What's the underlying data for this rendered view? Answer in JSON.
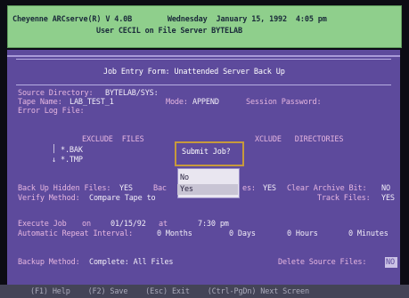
{
  "header": {
    "line1": "Cheyenne ARCserve(R) V 4.0B        Wednesday  January 15, 1992  4:05 pm",
    "line2": "User CECIL on File Server BYTELAB"
  },
  "form": {
    "title": "Job Entry Form: Unattended Server Back Up",
    "source_label": "Source Directory:",
    "source_value": "BYTELAB/SYS:",
    "tape_label": "Tape Name:",
    "tape_value": "LAB_TEST_1",
    "mode_label": "Mode:",
    "mode_value": "APPEND",
    "session_label": "Session Password:",
    "errorlog_label": "Error Log File:",
    "exclude_files_label": "EXCLUDE  FILES",
    "exclude_files": [
      "*.BAK",
      "*.TMP"
    ],
    "exclude_dirs_label": "XCLUDE   DIRECTORIES",
    "hidden_label": "Back Up Hidden Files:",
    "hidden_value": "YES",
    "hidden_trunc": "Bac",
    "system_label": "es:",
    "system_value": "YES",
    "archive_label": "Clear Archive Bit:",
    "archive_value": "NO",
    "verify_label": "Verify Method:",
    "verify_value": "Compare Tape to",
    "track_label": "Track Files:",
    "track_value": "YES",
    "execute_label": "Execute Job",
    "execute_on": "on",
    "execute_date": "01/15/92",
    "execute_at": "at",
    "execute_time": "7:30 pm",
    "repeat_label": "Automatic Repeat Interval:",
    "repeat_months": "0 Months",
    "repeat_days": "0 Days",
    "repeat_hours": "0 Hours",
    "repeat_minutes": "0 Minutes",
    "method_label": "Backup Method:",
    "method_value": "Complete: All Files",
    "delete_label": "Delete Source Files:",
    "delete_value": "NO"
  },
  "dialog": {
    "title": "Submit Job?",
    "options": [
      "No",
      "Yes"
    ]
  },
  "footer": {
    "keys": "(F1) Help    (F2) Save    (Esc) Exit    (Ctrl-PgDn) Next Screen"
  },
  "colors": {
    "header_bg": "#8fcf8c",
    "screen_bg": "#5d4a9c",
    "label": "#e6b6e0",
    "value": "#f2eef8",
    "dialog_border": "#c79a3c"
  }
}
